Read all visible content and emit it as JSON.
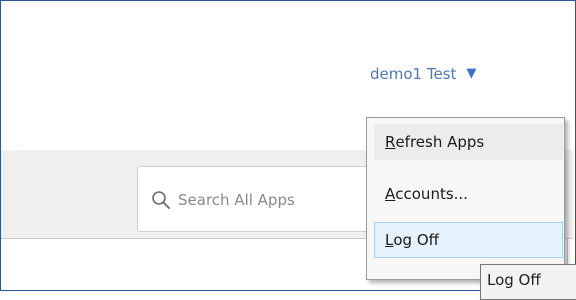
{
  "header": {
    "user_name": "demo1 Test",
    "caret_icon": "caret-down-icon"
  },
  "search": {
    "placeholder": "Search All Apps",
    "icon": "search-icon"
  },
  "dropdown": {
    "items": [
      {
        "mnemonic": "R",
        "rest": "efresh Apps"
      },
      {
        "mnemonic": "A",
        "rest": "ccounts..."
      },
      {
        "mnemonic": "L",
        "rest": "og Off"
      }
    ]
  },
  "tooltip": {
    "text": "Log Off"
  },
  "colors": {
    "accent": "#4f78b8",
    "frame_border": "#2f5597",
    "hover_fill": "#e5f1fb"
  }
}
